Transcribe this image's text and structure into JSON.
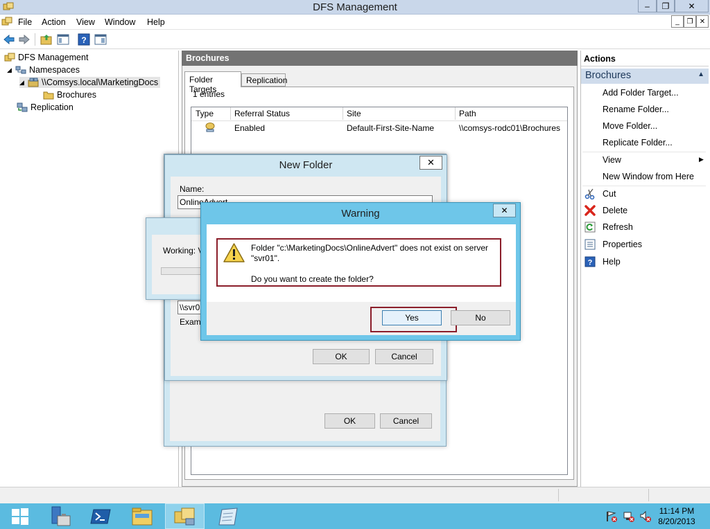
{
  "window": {
    "title": "DFS Management",
    "minimize": "–",
    "maximize": "❐",
    "close": "✕"
  },
  "menu": [
    "File",
    "Action",
    "View",
    "Window",
    "Help"
  ],
  "mdi": {
    "minimize": "_",
    "restore": "❐",
    "close": "✕"
  },
  "tree": {
    "root": "DFS Management",
    "namespaces": "Namespaces",
    "namespace": "\\\\Comsys.local\\MarketingDocs",
    "folder": "Brochures",
    "replication": "Replication"
  },
  "center": {
    "header": "Brochures",
    "tabs": [
      "Folder Targets",
      "Replication"
    ],
    "entries": "1 entries",
    "columns": [
      "Type",
      "Referral Status",
      "Site",
      "Path"
    ],
    "rows": [
      {
        "status": "Enabled",
        "site": "Default-First-Site-Name",
        "path": "\\\\comsys-rodc01\\Brochures"
      }
    ]
  },
  "actions": {
    "header": "Actions",
    "context": "Brochures",
    "items": [
      "Add Folder Target...",
      "Rename Folder...",
      "Move Folder...",
      "Replicate Folder...",
      "View",
      "New Window from Here",
      "Cut",
      "Delete",
      "Refresh",
      "Properties",
      "Help"
    ]
  },
  "new_folder_dialog": {
    "title": "New Folder",
    "close": "✕",
    "name_label": "Name:",
    "name_value": "OnlineAdvert",
    "target_value": "\\\\svr01",
    "example_label": "Examp",
    "ok": "OK",
    "cancel": "Cancel",
    "outer_ok": "OK",
    "outer_cancel": "Cancel"
  },
  "working_dialog": {
    "text": "Working: Va"
  },
  "warning_dialog": {
    "title": "Warning",
    "close": "✕",
    "message_line1": "Folder \"c:\\MarketingDocs\\OnlineAdvert\" does not exist on server",
    "message_line2": "\"svr01\".",
    "question": "Do you want to create the folder?",
    "yes": "Yes",
    "no": "No"
  },
  "taskbar": {
    "time": "11:14 PM",
    "date": "8/20/2013"
  },
  "colors": {
    "taskbar": "#5bbbe0",
    "highlight_box": "#8b1e2a",
    "dialog_frame": "#cfe7f2",
    "actions_context": "#cfdcec"
  }
}
